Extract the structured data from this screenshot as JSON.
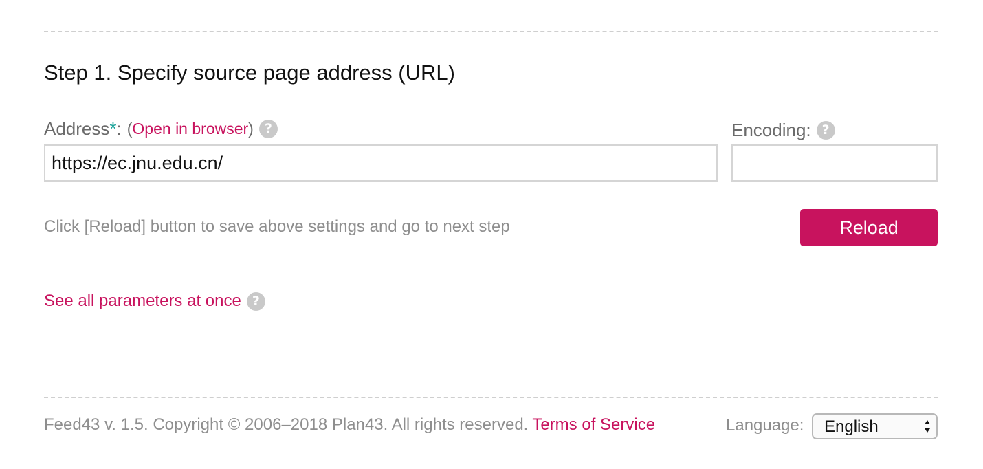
{
  "step": {
    "title": "Step 1. Specify source page address (URL)"
  },
  "address": {
    "label": "Address",
    "required_marker": "*",
    "colon": ":",
    "open_paren": "(",
    "open_link": "Open in browser",
    "close_paren": ")",
    "value": "https://ec.jnu.edu.cn/",
    "help_icon": "question-circle-icon"
  },
  "encoding": {
    "label": "Encoding:",
    "value": "",
    "help_icon": "question-circle-icon"
  },
  "hint": "Click [Reload] button to save above settings and go to next step",
  "reload_button": "Reload",
  "see_all": {
    "label": "See all parameters at once",
    "help_icon": "question-circle-icon"
  },
  "footer": {
    "copyright": "Feed43 v. 1.5. Copyright © 2006–2018 Plan43. All rights reserved.",
    "terms": "Terms of Service",
    "language_label": "Language:",
    "language_value": "English"
  },
  "colors": {
    "accent": "#c8135e",
    "required": "#1aa39a",
    "muted_text": "#8e8e8e",
    "help_icon": "#c9c9c9"
  }
}
